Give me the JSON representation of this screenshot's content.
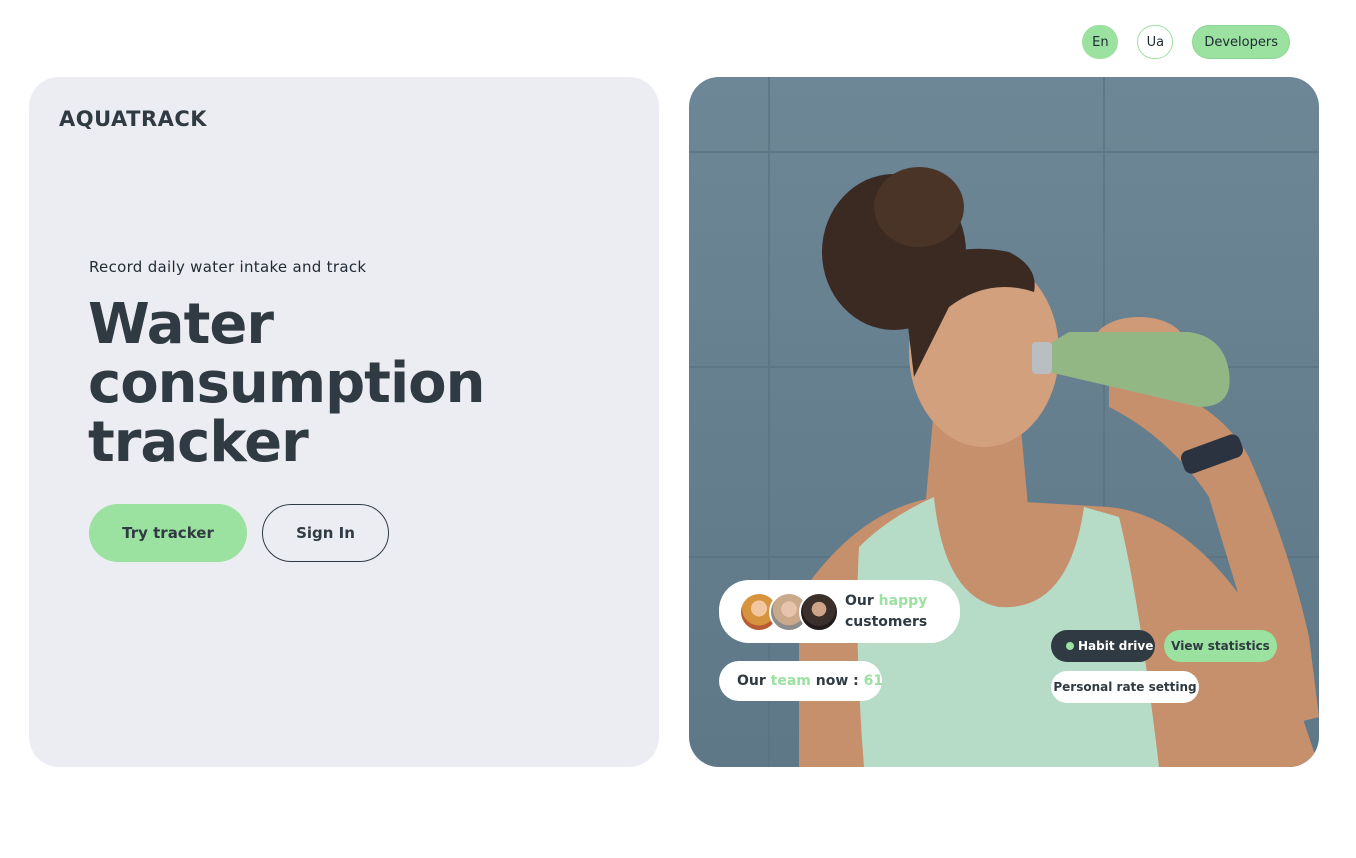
{
  "nav": {
    "lang_en": "En",
    "lang_ua": "Ua",
    "developers": "Developers"
  },
  "hero": {
    "logo": "AQUATRACK",
    "tagline": "Record daily water intake and track",
    "title": "Water consumption tracker",
    "try_button": "Try tracker",
    "signin_button": "Sign In"
  },
  "badges": {
    "customers_prefix": "Our ",
    "customers_accent": "happy",
    "customers_suffix": "customers",
    "team_prefix": "Our ",
    "team_accent": "team",
    "team_middle": " now : ",
    "team_count": "61",
    "habit": "Habit drive",
    "stats": "View statistics",
    "rate": "Personal rate setting"
  },
  "colors": {
    "accent": "#9be1a0",
    "dark": "#2f3a42",
    "panel_bg": "#ecedf3"
  }
}
